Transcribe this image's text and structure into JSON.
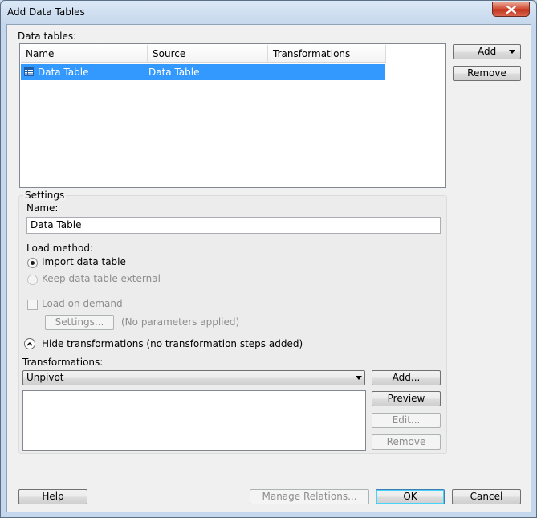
{
  "window": {
    "title": "Add Data Tables"
  },
  "data_tables": {
    "label": "Data tables:",
    "columns": [
      "Name",
      "Source",
      "Transformations"
    ],
    "rows": [
      {
        "name": "Data Table",
        "source": "Data Table",
        "transformations": "",
        "icon": "table-icon"
      }
    ]
  },
  "buttons": {
    "add": "Add",
    "remove": "Remove",
    "settings": "Settings...",
    "transform_add": "Add...",
    "preview": "Preview",
    "edit": "Edit...",
    "transform_remove": "Remove",
    "help": "Help",
    "manage_relations": "Manage Relations...",
    "ok": "OK",
    "cancel": "Cancel"
  },
  "settings": {
    "group_label": "Settings",
    "name_label": "Name:",
    "name_value": "Data Table",
    "load_method_label": "Load method:",
    "import_option": "Import data table",
    "external_option": "Keep data table external",
    "load_on_demand": "Load on demand",
    "parameters_status": "(No parameters applied)",
    "hide_transformations": "Hide transformations (no transformation steps added)",
    "transformations_label": "Transformations:",
    "transformation_selected": "Unpivot"
  },
  "colors": {
    "selection": "#3399ff",
    "close_button": "#c83a22"
  }
}
